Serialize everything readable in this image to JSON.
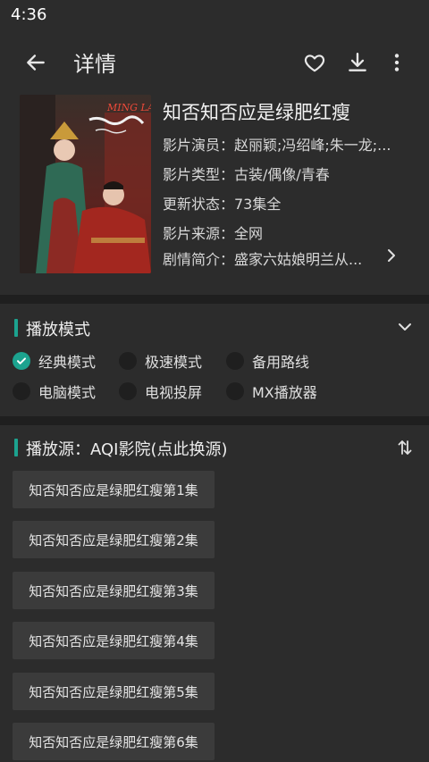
{
  "status_bar": {
    "time": "4:36"
  },
  "app_bar": {
    "title": "详情",
    "back_icon": "arrow-left-icon",
    "favorite_icon": "heart-outline-icon",
    "download_icon": "download-icon",
    "more_icon": "more-vertical-icon"
  },
  "movie": {
    "title": "知否知否应是绿肥红瘦",
    "poster_text": "MING LAN",
    "actors": "影片演员：赵丽颖;冯绍峰;朱一龙;...",
    "genre": "影片类型：古装/偶像/青春",
    "update_status": "更新状态：73集全",
    "source": "影片来源：全网",
    "synopsis": "剧情简介：盛家六姑娘明兰从..."
  },
  "play_mode": {
    "title": "播放模式",
    "toggle_icon": "chevron-down-icon",
    "options": [
      {
        "label": "经典模式",
        "selected": true
      },
      {
        "label": "极速模式",
        "selected": false
      },
      {
        "label": "备用路线",
        "selected": false
      },
      {
        "label": "电脑模式",
        "selected": false
      },
      {
        "label": "电视投屏",
        "selected": false
      },
      {
        "label": "MX播放器",
        "selected": false
      }
    ]
  },
  "play_source": {
    "title": "播放源：AQI影院(点此换源)",
    "sort_icon": "sort-icon",
    "episodes": [
      "知否知否应是绿肥红瘦第1集",
      "知否知否应是绿肥红瘦第2集",
      "知否知否应是绿肥红瘦第3集",
      "知否知否应是绿肥红瘦第4集",
      "知否知否应是绿肥红瘦第5集",
      "知否知否应是绿肥红瘦第6集"
    ]
  },
  "colors": {
    "accent": "#1ca38f",
    "background": "#2c2c2c",
    "divider": "#1f1f1f",
    "chip": "#3b3b3b"
  }
}
